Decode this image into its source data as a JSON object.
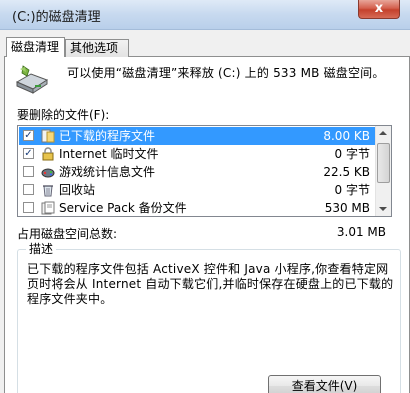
{
  "window": {
    "title": "(C:)的磁盘清理",
    "close_label": "x"
  },
  "tabs": [
    {
      "label": "磁盘清理",
      "active": true
    },
    {
      "label": "其他选项",
      "active": false
    }
  ],
  "intro": {
    "text": "可以使用“磁盘清理”来释放 (C:) 上的 533 MB 磁盘空间。"
  },
  "files_section": {
    "label": "要删除的文件(F):"
  },
  "file_list": [
    {
      "name": "已下载的程序文件",
      "size": "8.00 KB",
      "checked": true,
      "selected": true,
      "icon": "folder-icon"
    },
    {
      "name": "Internet 临时文件",
      "size": "0 字节",
      "checked": true,
      "selected": false,
      "icon": "lock-icon"
    },
    {
      "name": "游戏统计信息文件",
      "size": "22.5 KB",
      "checked": false,
      "selected": false,
      "icon": "game-controller-icon"
    },
    {
      "name": "回收站",
      "size": "0 字节",
      "checked": false,
      "selected": false,
      "icon": "recycle-bin-icon"
    },
    {
      "name": "Service Pack 备份文件",
      "size": "530 MB",
      "checked": false,
      "selected": false,
      "icon": "backup-icon"
    }
  ],
  "total": {
    "label": "占用磁盘空间总数:",
    "value": "3.01 MB"
  },
  "description": {
    "title": "描述",
    "text": "已下载的程序文件包括 ActiveX 控件和 Java 小程序,你查看特定网页时将会从 Internet 自动下载它们,并临时保存在硬盘上的已下载的程序文件夹中。"
  },
  "buttons": {
    "view_files": "查看文件(V)"
  },
  "colors": {
    "selection": "#3399ff",
    "window_bg": "#f0f0f0",
    "panel_bg": "#ffffff"
  }
}
